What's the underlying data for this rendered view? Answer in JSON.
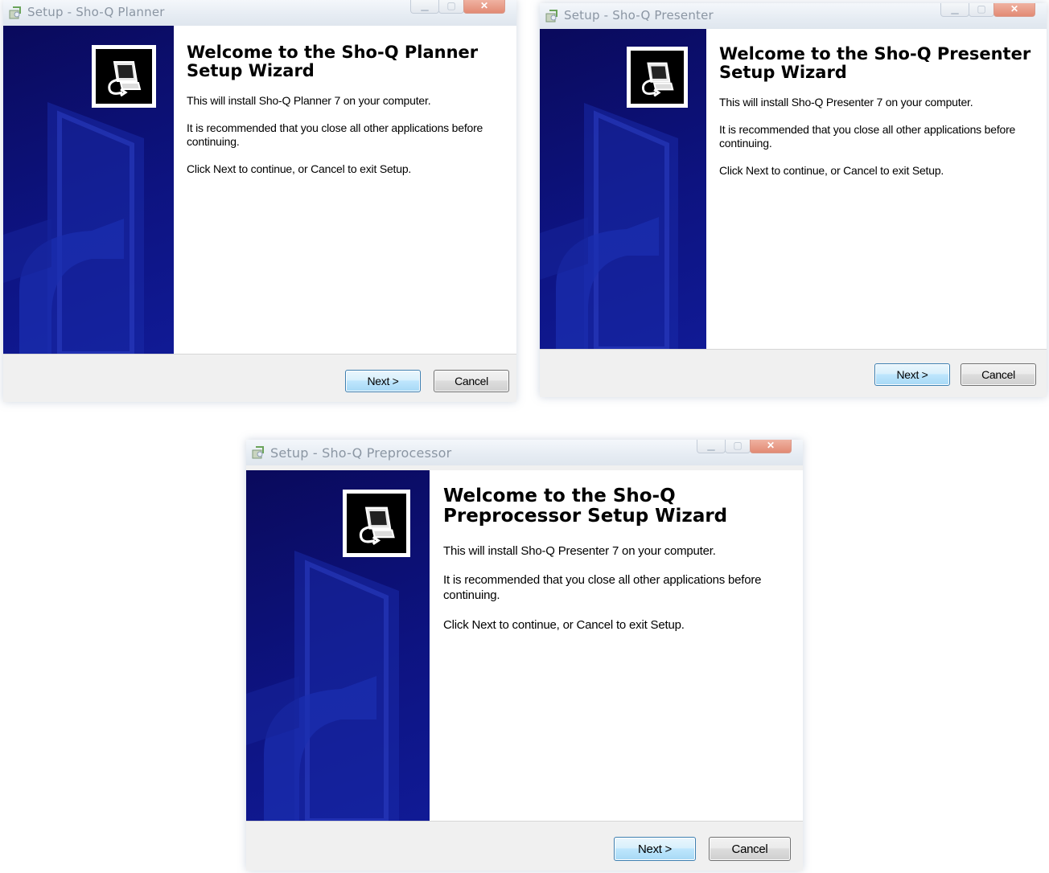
{
  "windows": [
    {
      "id": "planner",
      "title": "Setup - Sho-Q Planner",
      "heading_line1": "Welcome to the Sho-Q Planner",
      "heading_line2": "Setup Wizard",
      "install_text": "This will install Sho-Q Planner 7 on your computer.",
      "recommend_text": "It is recommended that you close all other applications before continuing.",
      "continue_text": "Click Next to continue, or Cancel to exit Setup.",
      "next_label": "Next >",
      "cancel_label": "Cancel"
    },
    {
      "id": "presenter",
      "title": "Setup - Sho-Q Presenter",
      "heading_line1": "Welcome to the Sho-Q Presenter",
      "heading_line2": "Setup Wizard",
      "install_text": "This will install Sho-Q Presenter 7 on your computer.",
      "recommend_text": "It is recommended that you close all other applications before continuing.",
      "continue_text": "Click Next to continue, or Cancel to exit Setup.",
      "next_label": "Next >",
      "cancel_label": "Cancel"
    },
    {
      "id": "preprocessor",
      "title": "Setup - Sho-Q Preprocessor",
      "heading_line1": "Welcome to the Sho-Q",
      "heading_line2": "Preprocessor Setup Wizard",
      "install_text": "This will install Sho-Q Presenter 7 on your computer.",
      "recommend_text": "It is recommended that you close all other applications before continuing.",
      "continue_text": "Click Next to continue, or Cancel to exit Setup.",
      "next_label": "Next >",
      "cancel_label": "Cancel"
    }
  ],
  "colors": {
    "sidebar_blue": "#0d1380",
    "next_button_border": "#3c7fb1",
    "title_text": "#8b96a3"
  },
  "icons": {
    "window_icon": "setup-installer-icon",
    "wizard_logo": "computer-install-icon"
  }
}
